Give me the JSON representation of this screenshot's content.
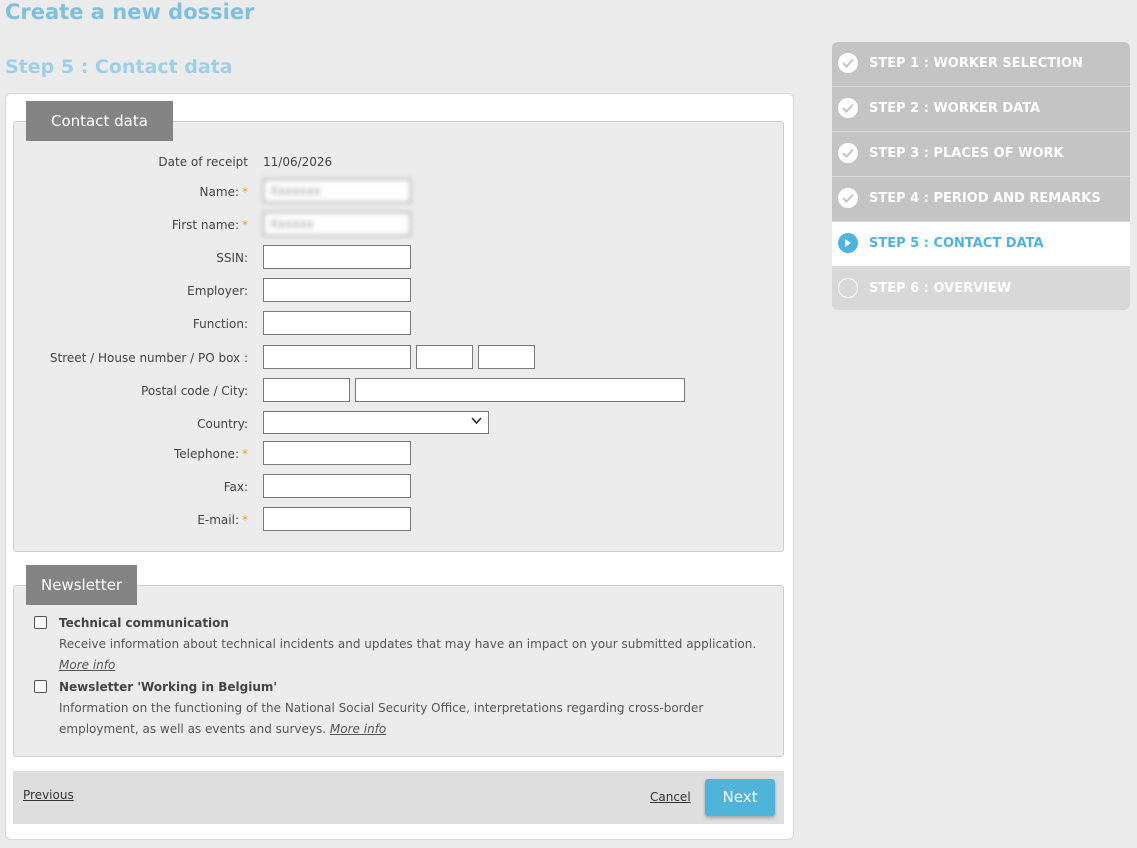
{
  "page": {
    "title": "Create a new dossier",
    "step_title": "Step 5 : Contact data"
  },
  "contact": {
    "legend": "Contact data",
    "date_label": "Date of receipt",
    "date_value": "11/06/2026",
    "name_label": "Name:",
    "name_value": "Xxxxxxx",
    "firstname_label": "First name:",
    "firstname_value": "Xxxxxx",
    "ssin_label": "SSIN:",
    "employer_label": "Employer:",
    "function_label": "Function:",
    "street_label": "Street / House number / PO box :",
    "postal_label": "Postal code / City:",
    "country_label": "Country:",
    "telephone_label": "Telephone:",
    "fax_label": "Fax:",
    "email_label": "E-mail:",
    "required_mark": "*"
  },
  "newsletter": {
    "legend": "Newsletter",
    "tech_title": "Technical communication",
    "tech_desc": "Receive information about technical incidents and updates that may have an impact on your submitted application.",
    "more_info": "More info",
    "wib_title": "Newsletter 'Working in Belgium'",
    "wib_desc": "Information on the functioning of the National Social Security Office, interpretations regarding cross-border employment, as well as events and surveys."
  },
  "footer": {
    "previous": "Previous",
    "cancel": "Cancel",
    "next": "Next"
  },
  "steps": [
    {
      "label": "STEP 1 : WORKER SELECTION",
      "state": "done"
    },
    {
      "label": "STEP 2 : WORKER DATA",
      "state": "done"
    },
    {
      "label": "STEP 3 : PLACES OF WORK",
      "state": "done"
    },
    {
      "label": "STEP 4 : PERIOD AND REMARKS",
      "state": "done"
    },
    {
      "label": "STEP 5 : CONTACT DATA",
      "state": "active"
    },
    {
      "label": "STEP 6 : OVERVIEW",
      "state": "pending"
    }
  ],
  "colors": {
    "accent": "#4fb3da",
    "title": "#7fc0df",
    "required": "#f0a234",
    "step_done_bg": "#c4c4c4",
    "legend_bg": "#848484"
  }
}
